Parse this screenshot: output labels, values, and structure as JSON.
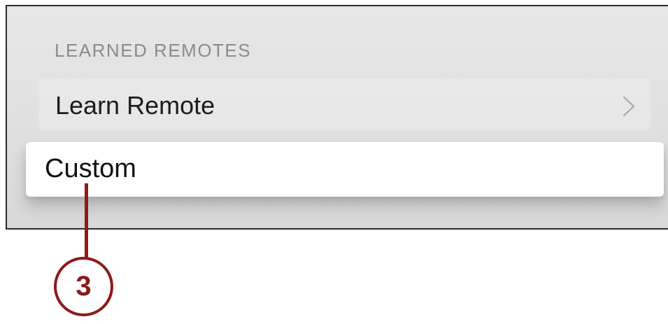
{
  "section": {
    "header": "LEARNED REMOTES"
  },
  "rows": {
    "learn_remote": "Learn Remote",
    "custom": "Custom"
  },
  "icons": {
    "chevron": "chevron-right-icon"
  },
  "callout": {
    "number": "3",
    "color": "#8b1a1a"
  }
}
